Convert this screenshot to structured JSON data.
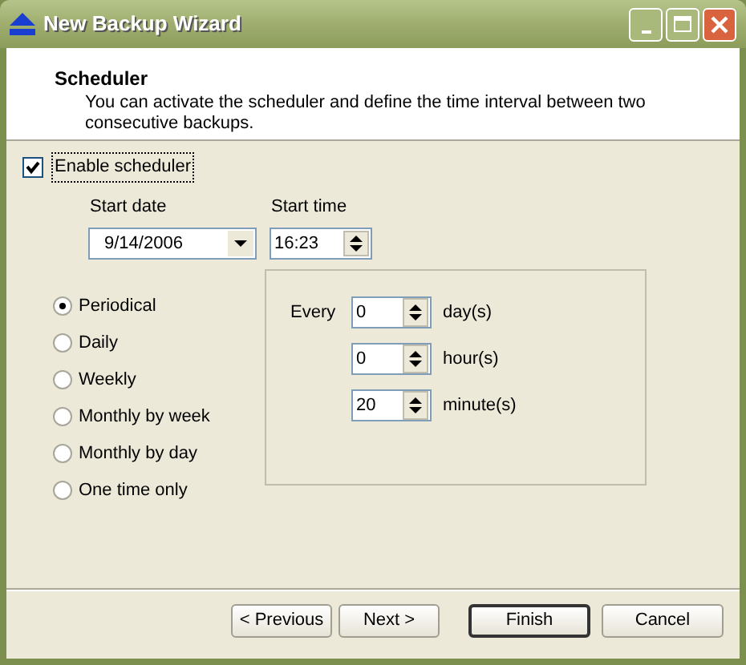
{
  "window": {
    "title": "New Backup Wizard"
  },
  "header": {
    "title": "Scheduler",
    "description": "You can activate the scheduler and define the time interval between two consecutive backups."
  },
  "enable_scheduler": {
    "label": "Enable scheduler",
    "checked": true
  },
  "start_date": {
    "label": "Start date",
    "value": "9/14/2006"
  },
  "start_time": {
    "label": "Start time",
    "value": "16:23"
  },
  "schedule_types": [
    {
      "label": "Periodical",
      "selected": true
    },
    {
      "label": "Daily",
      "selected": false
    },
    {
      "label": "Weekly",
      "selected": false
    },
    {
      "label": "Monthly by week",
      "selected": false
    },
    {
      "label": "Monthly by day",
      "selected": false
    },
    {
      "label": "One time only",
      "selected": false
    }
  ],
  "interval": {
    "prefix": "Every",
    "fields": [
      {
        "value": "0",
        "unit": "day(s)"
      },
      {
        "value": "0",
        "unit": "hour(s)"
      },
      {
        "value": "20",
        "unit": "minute(s)"
      }
    ]
  },
  "buttons": [
    {
      "label": "< Previous",
      "default": false
    },
    {
      "label": "Next >",
      "default": false
    },
    {
      "label": "Finish",
      "default": true
    },
    {
      "label": "Cancel",
      "default": false
    }
  ]
}
